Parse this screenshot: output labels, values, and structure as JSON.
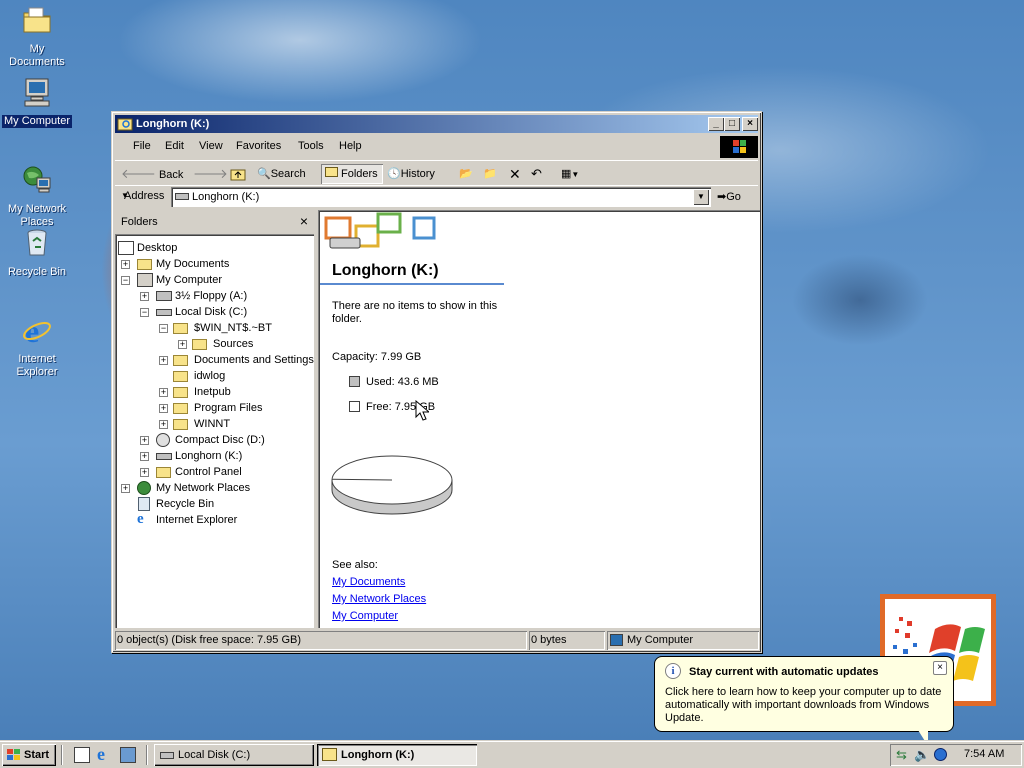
{
  "desktop": {
    "icons": [
      {
        "label": "My Documents"
      },
      {
        "label": "My Computer"
      },
      {
        "label": "My Network\nPlaces"
      },
      {
        "label": "Recycle Bin"
      },
      {
        "label": "Internet\nExplorer"
      }
    ]
  },
  "window": {
    "title": "Longhorn (K:)",
    "menu": [
      "File",
      "Edit",
      "View",
      "Favorites",
      "Tools",
      "Help"
    ],
    "toolbar": {
      "back": "Back",
      "search": "Search",
      "folders": "Folders",
      "history": "History"
    },
    "address": {
      "label": "Address",
      "value": "Longhorn (K:)",
      "go": "Go"
    },
    "folders_pane": {
      "title": "Folders",
      "tree": [
        {
          "label": "Desktop"
        },
        {
          "label": "My Documents"
        },
        {
          "label": "My Computer"
        },
        {
          "label": "3½ Floppy (A:)"
        },
        {
          "label": "Local Disk (C:)"
        },
        {
          "label": "$WIN_NT$.~BT"
        },
        {
          "label": "Sources"
        },
        {
          "label": "Documents and Settings"
        },
        {
          "label": "idwlog"
        },
        {
          "label": "Inetpub"
        },
        {
          "label": "Program Files"
        },
        {
          "label": "WINNT"
        },
        {
          "label": "Compact Disc (D:)"
        },
        {
          "label": "Longhorn (K:)"
        },
        {
          "label": "Control Panel"
        },
        {
          "label": "My Network Places"
        },
        {
          "label": "Recycle Bin"
        },
        {
          "label": "Internet Explorer"
        }
      ]
    },
    "content": {
      "heading": "Longhorn (K:)",
      "empty_message": "There are no items to show in this folder.",
      "capacity": "Capacity: 7.99 GB",
      "used": "Used: 43.6 MB",
      "free": "Free: 7.95 GB",
      "used_fraction": 0.0053,
      "see_also": "See also:",
      "links": [
        "My Documents",
        "My Network Places",
        "My Computer"
      ]
    },
    "status": {
      "objects": "0 object(s) (Disk free space: 7.95 GB)",
      "size": "0 bytes",
      "zone": "My Computer"
    }
  },
  "balloon": {
    "title": "Stay current with automatic updates",
    "body": "Click here to learn how to keep your computer up to date automatically with important downloads from Windows Update."
  },
  "taskbar": {
    "start": "Start",
    "tasks": [
      "Local Disk (C:)",
      "Longhorn (K:)"
    ],
    "clock": "7:54 AM"
  },
  "colors": {
    "title_active": "#0a246a",
    "title_gradient_end": "#a6caf0",
    "face": "#d4d0c8",
    "desktop": "#3a6ea5",
    "link": "#0000ee",
    "tooltip": "#ffffe1"
  }
}
